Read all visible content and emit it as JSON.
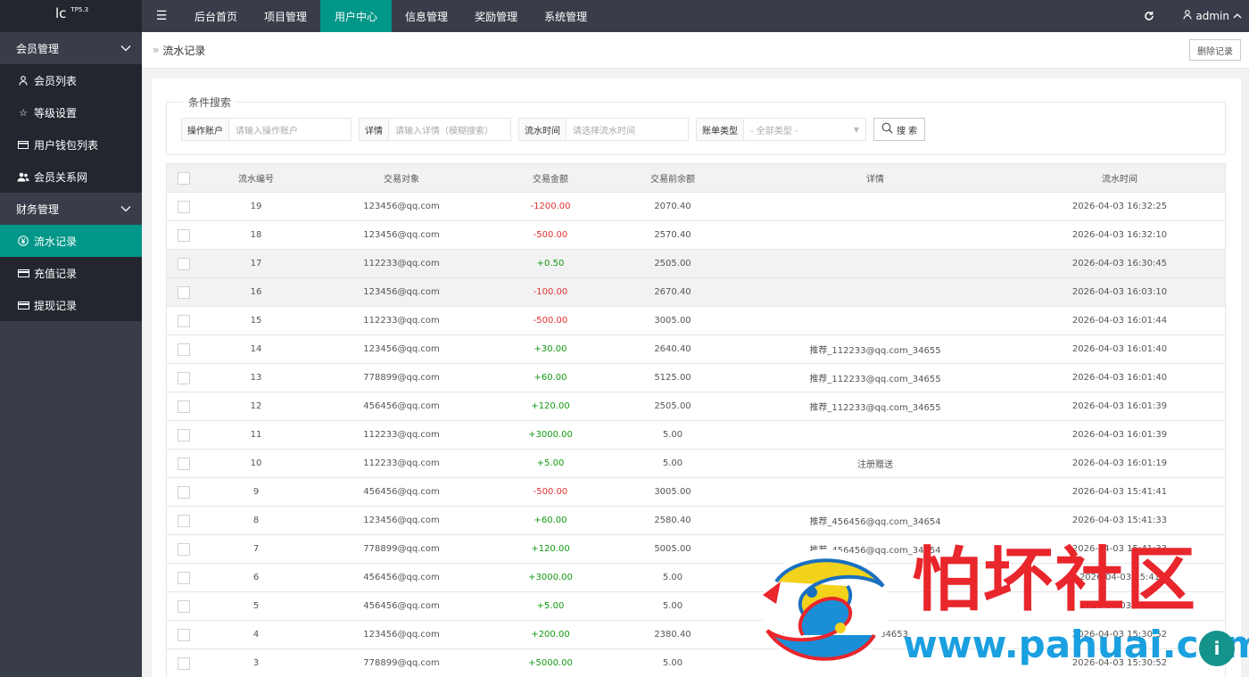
{
  "logo": {
    "text": "lc",
    "version": "TP5.3"
  },
  "topnav": {
    "menu_icon": "hamburger-icon",
    "items": [
      "后台首页",
      "项目管理",
      "用户中心",
      "信息管理",
      "奖励管理",
      "系统管理"
    ],
    "active": "用户中心",
    "user": "admin"
  },
  "sidebar": {
    "group1": "会员管理",
    "group1_items": [
      {
        "label": "会员列表",
        "icon": "user-icon"
      },
      {
        "label": "等级设置",
        "icon": "star-icon"
      },
      {
        "label": "用户钱包列表",
        "icon": "wallet-icon"
      },
      {
        "label": "会员关系网",
        "icon": "users-icon"
      }
    ],
    "group2": "财务管理",
    "group2_items": [
      {
        "label": "流水记录",
        "icon": "yen-icon"
      },
      {
        "label": "充值记录",
        "icon": "card-icon"
      },
      {
        "label": "提现记录",
        "icon": "card-icon"
      }
    ]
  },
  "crumb": {
    "title": "流水记录",
    "delete_btn": "删除记录"
  },
  "search": {
    "legend": "条件搜索",
    "account_label": "操作账户",
    "account_placeholder": "请输入操作账户",
    "detail_label": "详情",
    "detail_placeholder": "请输入详情（模糊搜索）",
    "time_label": "流水时间",
    "time_placeholder": "请选择流水时间",
    "type_label": "账单类型",
    "type_value": "- 全部类型 -",
    "search_btn": "搜 索"
  },
  "table": {
    "headers": [
      "流水编号",
      "交易对象",
      "交易金额",
      "交易前余额",
      "详情",
      "流水时间"
    ],
    "rows": [
      {
        "id": "19",
        "obj": "123456@qq.com",
        "amt": "-1200.00",
        "bal": "2070.40",
        "detail": "",
        "time": "2026-04-03 16:32:25"
      },
      {
        "id": "18",
        "obj": "123456@qq.com",
        "amt": "-500.00",
        "bal": "2570.40",
        "detail": "",
        "time": "2026-04-03 16:32:10"
      },
      {
        "id": "17",
        "obj": "112233@qq.com",
        "amt": "+0.50",
        "bal": "2505.00",
        "detail": "",
        "time": "2026-04-03 16:30:45"
      },
      {
        "id": "16",
        "obj": "123456@qq.com",
        "amt": "-100.00",
        "bal": "2670.40",
        "detail": "",
        "time": "2026-04-03 16:03:10"
      },
      {
        "id": "15",
        "obj": "112233@qq.com",
        "amt": "-500.00",
        "bal": "3005.00",
        "detail": "",
        "time": "2026-04-03 16:01:44"
      },
      {
        "id": "14",
        "obj": "123456@qq.com",
        "amt": "+30.00",
        "bal": "2640.40",
        "detail": "推荐_112233@qq.com_34655",
        "time": "2026-04-03 16:01:40"
      },
      {
        "id": "13",
        "obj": "778899@qq.com",
        "amt": "+60.00",
        "bal": "5125.00",
        "detail": "推荐_112233@qq.com_34655",
        "time": "2026-04-03 16:01:40"
      },
      {
        "id": "12",
        "obj": "456456@qq.com",
        "amt": "+120.00",
        "bal": "2505.00",
        "detail": "推荐_112233@qq.com_34655",
        "time": "2026-04-03 16:01:39"
      },
      {
        "id": "11",
        "obj": "112233@qq.com",
        "amt": "+3000.00",
        "bal": "5.00",
        "detail": "",
        "time": "2026-04-03 16:01:39"
      },
      {
        "id": "10",
        "obj": "112233@qq.com",
        "amt": "+5.00",
        "bal": "5.00",
        "detail": "注册赠送",
        "time": "2026-04-03 16:01:19"
      },
      {
        "id": "9",
        "obj": "456456@qq.com",
        "amt": "-500.00",
        "bal": "3005.00",
        "detail": "",
        "time": "2026-04-03 15:41:41"
      },
      {
        "id": "8",
        "obj": "123456@qq.com",
        "amt": "+60.00",
        "bal": "2580.40",
        "detail": "推荐_456456@qq.com_34654",
        "time": "2026-04-03 15:41:33"
      },
      {
        "id": "7",
        "obj": "778899@qq.com",
        "amt": "+120.00",
        "bal": "5005.00",
        "detail": "推荐_456456@qq.com_34654",
        "time": "2026-04-03 15:41:33"
      },
      {
        "id": "6",
        "obj": "456456@qq.com",
        "amt": "+3000.00",
        "bal": "5.00",
        "detail": "",
        "time": "2026-04-03 15:41"
      },
      {
        "id": "5",
        "obj": "456456@qq.com",
        "amt": "+5.00",
        "bal": "5.00",
        "detail": "送",
        "time": "2026-04-03 15:41"
      },
      {
        "id": "4",
        "obj": "123456@qq.com",
        "amt": "+200.00",
        "bal": "2380.40",
        "detail": "qq.com_34653",
        "time": "2026-04-03 15:30:52"
      },
      {
        "id": "3",
        "obj": "778899@qq.com",
        "amt": "+5000.00",
        "bal": "5.00",
        "detail": "",
        "time": "2026-04-03 15:30:52"
      }
    ]
  },
  "watermark": {
    "title": "怕坏社区",
    "url": "www.pahuai.com"
  },
  "colors": {
    "accent": "#009688",
    "dark": "#393d49",
    "negative": "#e03030",
    "positive": "#119911"
  }
}
